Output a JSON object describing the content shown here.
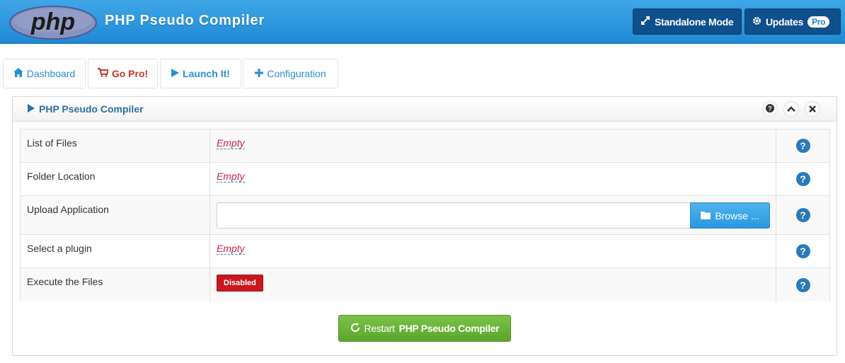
{
  "header": {
    "logo_text": "php",
    "title": "PHP Pseudo Compiler",
    "standalone_label": "Standalone Mode",
    "updates_label": "Updates",
    "updates_badge": "Pro",
    "accent_color": "#2b95dd"
  },
  "tabs": [
    {
      "label": "Dashboard",
      "icon": "home-icon"
    },
    {
      "label": "Go Pro!",
      "icon": "cart-icon"
    },
    {
      "label": "Launch It!",
      "icon": "play-icon"
    },
    {
      "label": "Configuration",
      "icon": "plus-icon"
    }
  ],
  "panel": {
    "title": "PHP Pseudo Compiler",
    "rows": [
      {
        "label": "List of Files",
        "value": "Empty"
      },
      {
        "label": "Folder Location",
        "value": "Empty"
      },
      {
        "label": "Upload Application",
        "value": "",
        "button": "Browse ..."
      },
      {
        "label": "Select a plugin",
        "value": "Empty"
      },
      {
        "label": "Execute the Files",
        "value": "Disabled"
      }
    ],
    "restart_prefix": "Restart",
    "restart_bold": "PHP Pseudo Compiler"
  }
}
